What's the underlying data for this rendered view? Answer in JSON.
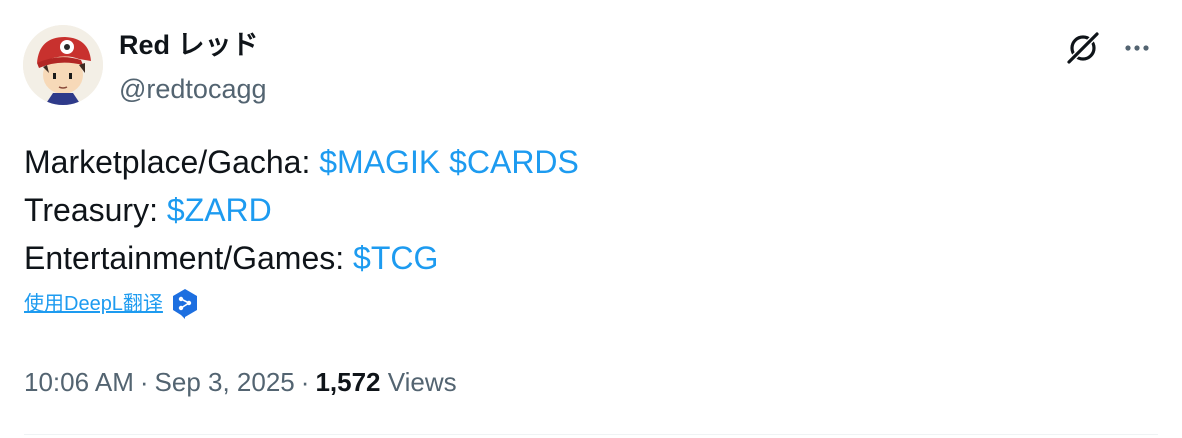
{
  "author": {
    "display_name": "Red レッド",
    "handle": "@redtocagg"
  },
  "icons": {
    "avatar": "avatar-image",
    "grok": "grok-icon",
    "more": "more-options-icon",
    "translate": "deepl-icon"
  },
  "tweet": {
    "lines": [
      {
        "label": "Marketplace/Gacha: ",
        "tags": [
          "$MAGIK",
          "$CARDS"
        ]
      },
      {
        "label": "Treasury: ",
        "tags": [
          "$ZARD"
        ]
      },
      {
        "label": "Entertainment/Games: ",
        "tags": [
          "$TCG"
        ]
      }
    ]
  },
  "translate_label": "使用DeepL翻译",
  "meta": {
    "time": "10:06 AM",
    "separator": "·",
    "date": "Sep 3, 2025",
    "views_count": "1,572",
    "views_label": "Views"
  },
  "colors": {
    "link": "#1d9bf0",
    "text": "#0f1419",
    "secondary": "#536471"
  }
}
